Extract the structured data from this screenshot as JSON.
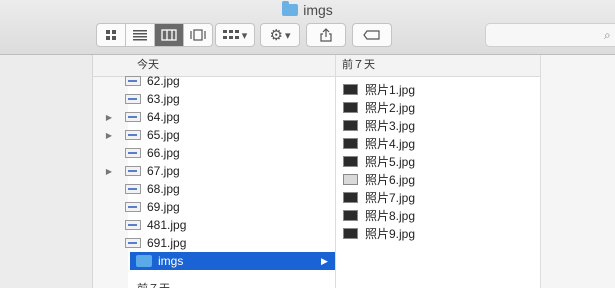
{
  "window": {
    "title": "imgs"
  },
  "toolbar": {
    "view_icons": [
      "icon-view",
      "list-view",
      "column-view",
      "gallery-view"
    ],
    "group_label": "▾",
    "action_label": "▾"
  },
  "columns": [
    {
      "header": "今天",
      "items": [
        {
          "name": "62.jpg",
          "expandable": false
        },
        {
          "name": "63.jpg",
          "expandable": false
        },
        {
          "name": "64.jpg",
          "expandable": true
        },
        {
          "name": "65.jpg",
          "expandable": true
        },
        {
          "name": "66.jpg",
          "expandable": false
        },
        {
          "name": "67.jpg",
          "expandable": true
        },
        {
          "name": "68.jpg",
          "expandable": false
        },
        {
          "name": "69.jpg",
          "expandable": false
        },
        {
          "name": "481.jpg",
          "expandable": false
        },
        {
          "name": "691.jpg",
          "expandable": false
        },
        {
          "name": "imgs",
          "expandable": false,
          "selected": true,
          "folder": true
        }
      ],
      "footer": "前７天"
    },
    {
      "header": "前７天",
      "items": [
        "照片1.jpg",
        "照片2.jpg",
        "照片3.jpg",
        "照片4.jpg",
        "照片5.jpg",
        "照片6.jpg",
        "照片7.jpg",
        "照片8.jpg",
        "照片9.jpg"
      ]
    }
  ],
  "colors": {
    "selection": "#1a63d4",
    "folder": "#5aa9e8"
  }
}
